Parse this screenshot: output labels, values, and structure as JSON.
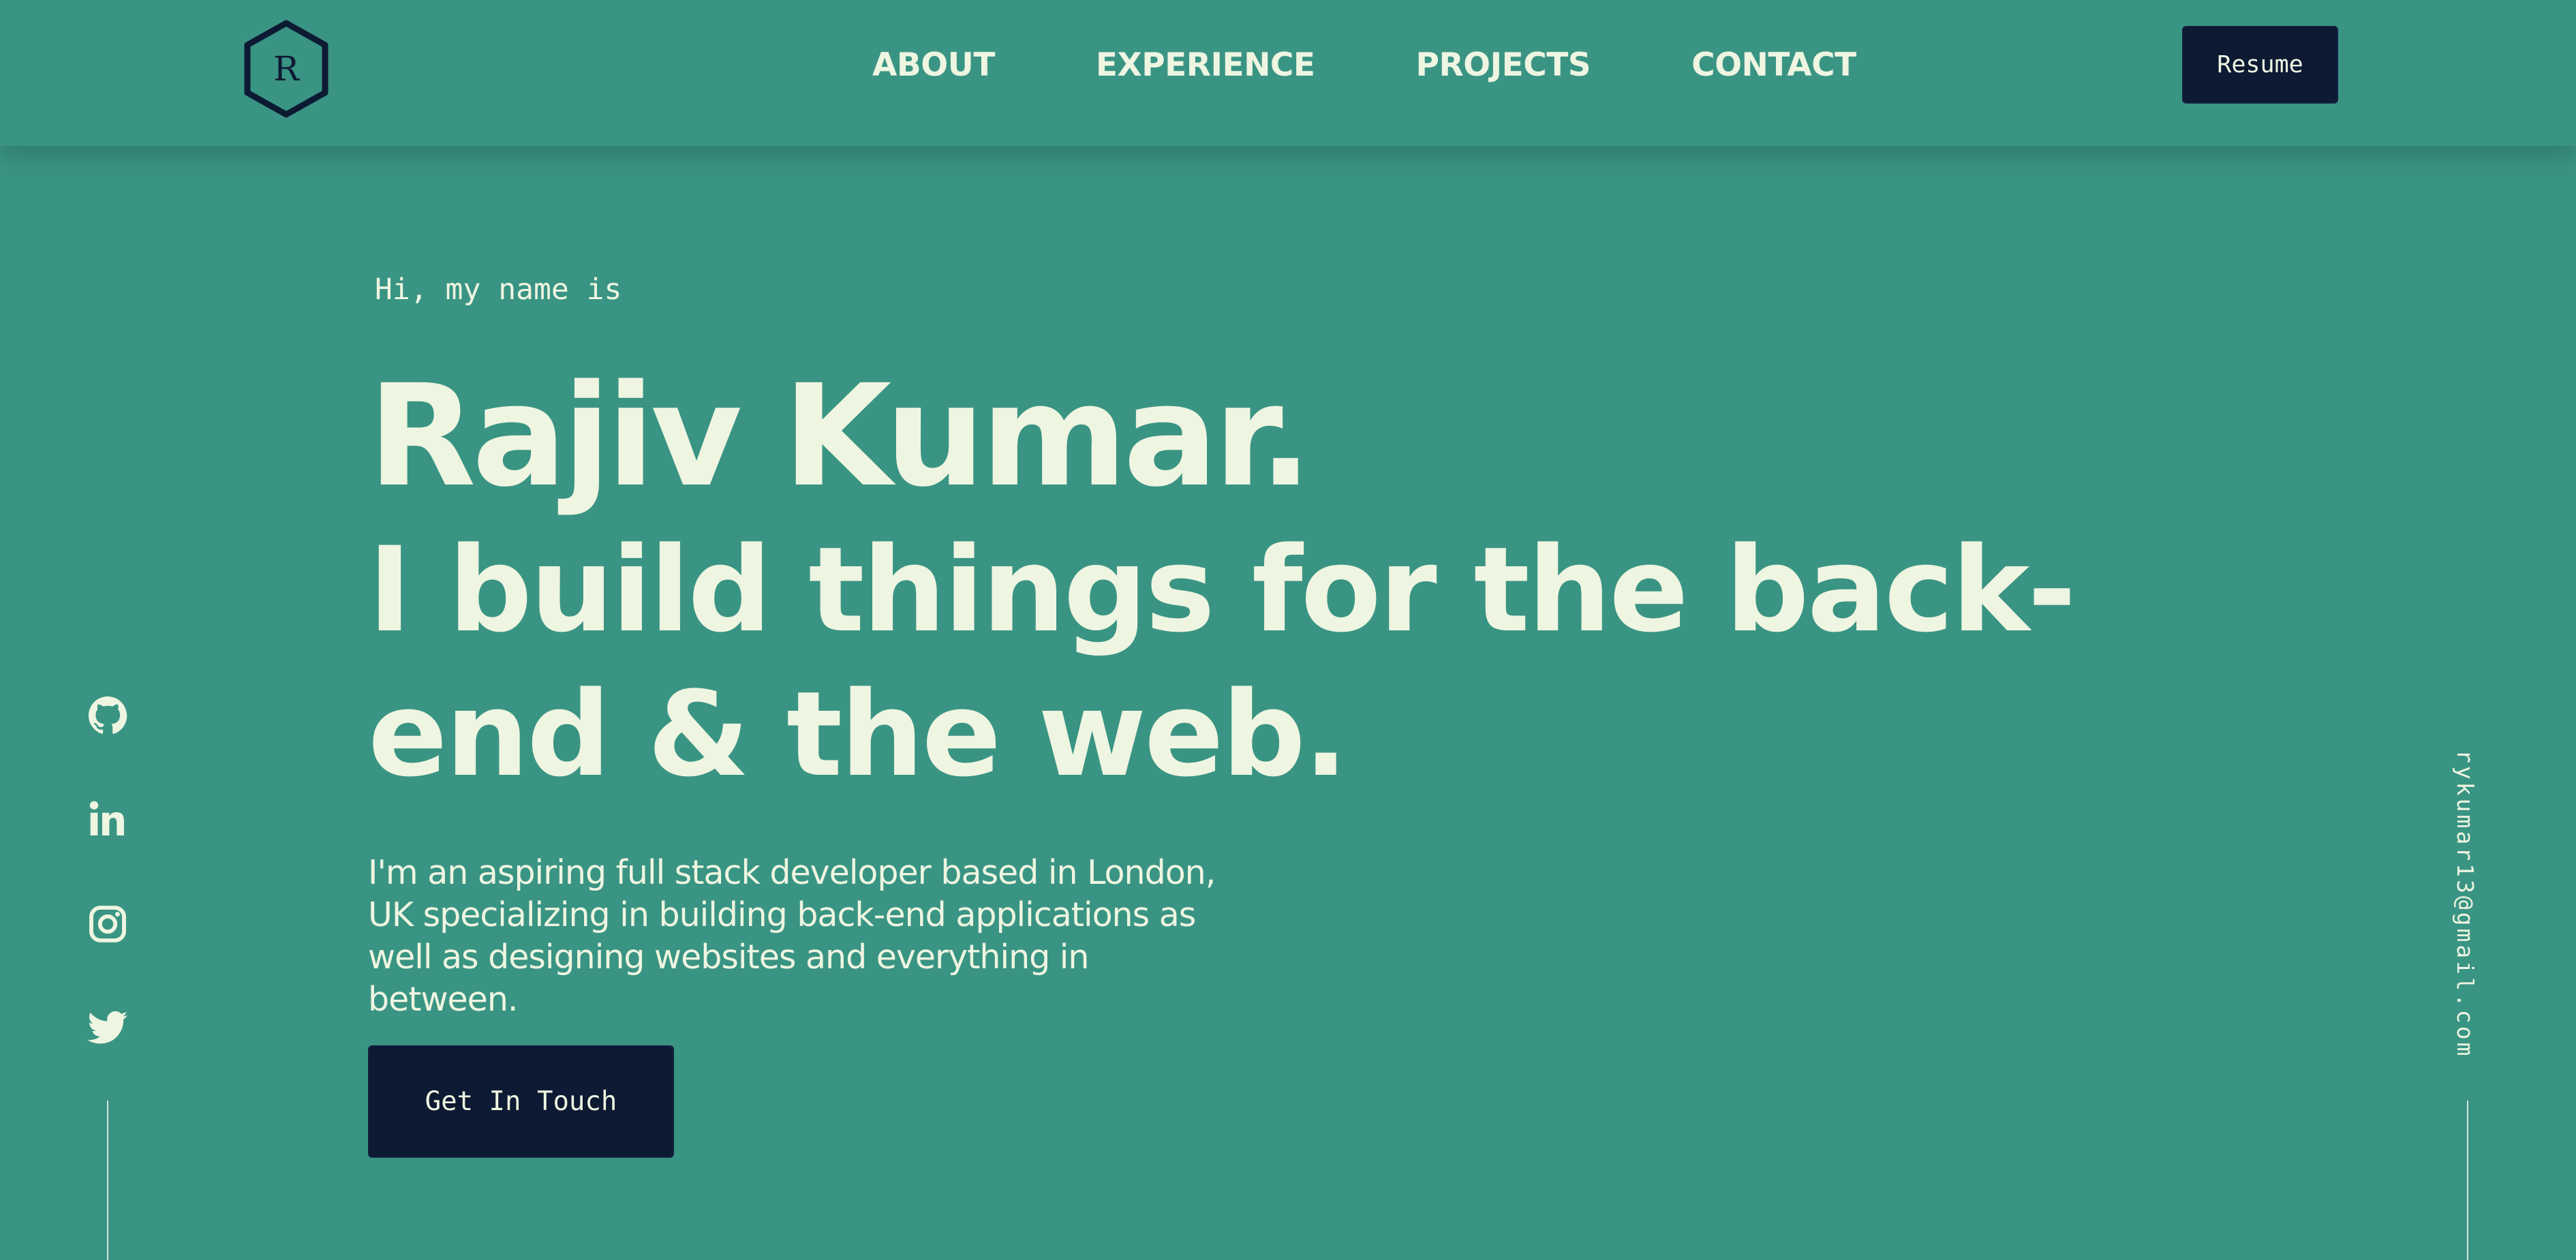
{
  "logo": {
    "letter": "R"
  },
  "nav": {
    "items": [
      {
        "label": "ABOUT"
      },
      {
        "label": "EXPERIENCE"
      },
      {
        "label": "PROJECTS"
      },
      {
        "label": "CONTACT"
      }
    ],
    "resume_label": "Resume"
  },
  "hero": {
    "greeting": "Hi, my name is",
    "name": "Rajiv Kumar.",
    "tagline": "I build things for the back-end & the web.",
    "intro": "I'm an aspiring full stack developer based in London, UK specializing in building back-end applications as well as designing websites and everything in between.",
    "cta_label": "Get In Touch"
  },
  "social": {
    "icons": [
      "github-icon",
      "linkedin-icon",
      "instagram-icon",
      "twitter-icon"
    ]
  },
  "email": "rykumar13@gmail.com",
  "colors": {
    "background": "#3a9483",
    "text": "#eef5e1",
    "button": "#0d1a33",
    "logo_stroke": "#0d1a33"
  }
}
